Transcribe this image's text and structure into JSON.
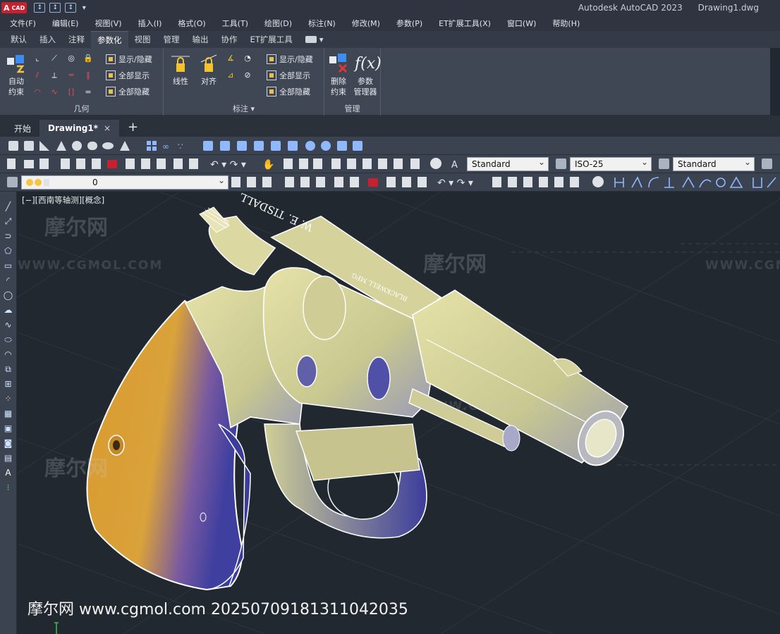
{
  "app": {
    "logo_letter": "A",
    "logo_text": "CAD",
    "title": "Autodesk AutoCAD 2023",
    "document": "Drawing1.dwg"
  },
  "menu": [
    "文件(F)",
    "编辑(E)",
    "视图(V)",
    "插入(I)",
    "格式(O)",
    "工具(T)",
    "绘图(D)",
    "标注(N)",
    "修改(M)",
    "参数(P)",
    "ET扩展工具(X)",
    "窗口(W)",
    "帮助(H)"
  ],
  "ribbon_tabs": [
    "默认",
    "插入",
    "注释",
    "参数化",
    "视图",
    "管理",
    "输出",
    "协作",
    "ET扩展工具"
  ],
  "ribbon_active_tab": "参数化",
  "ribbon": {
    "geometry": {
      "auto_constrain": "自动\n约束",
      "show_hide": "显示/隐藏",
      "show_all": "全部显示",
      "hide_all": "全部隐藏",
      "panel_label": "几何"
    },
    "dimension": {
      "linear": "线性",
      "aligned": "对齐",
      "show_hide": "显示/隐藏",
      "show_all": "全部显示",
      "hide_all": "全部隐藏",
      "panel_label": "标注 ▾"
    },
    "manage": {
      "delete_constraints": "删除\n约束",
      "params_manager": "参数\n管理器",
      "fx_glyph": "f(x)",
      "panel_label": "管理"
    }
  },
  "doc_tabs": {
    "start": "开始",
    "active": "Drawing1*",
    "close": "×",
    "new": "+"
  },
  "styles": {
    "text_style": "Standard",
    "dim_style": "ISO-25",
    "table_style": "Standard",
    "layer": "0"
  },
  "viewport": {
    "label": "[−][西南等轴测][概念]",
    "engraving_1": "W. E. TISDALL",
    "engraving_2": "BLACKWELL MFG",
    "watermark_cn": "摩尔网",
    "watermark_url": "WWW.CGMOL.COM",
    "footer": "摩尔网 www.cgmol.com 20250709181311042035"
  },
  "colors": {
    "brand_red": "#c7202e",
    "bg_dark": "#212830",
    "ribbon": "#3f4654"
  }
}
